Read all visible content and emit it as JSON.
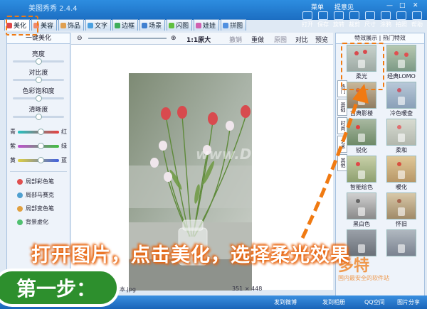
{
  "app": {
    "title": "美图秀秀 2.4.4",
    "menu": "菜单",
    "tip": "提意见"
  },
  "tabs": [
    {
      "label": "美化",
      "color": "#e04848"
    },
    {
      "label": "美容",
      "color": "#f08a6a"
    },
    {
      "label": "饰品",
      "color": "#e0a050"
    },
    {
      "label": "文字",
      "color": "#4aa0e0"
    },
    {
      "label": "边框",
      "color": "#3fae5a"
    },
    {
      "label": "场景",
      "color": "#4080d0"
    },
    {
      "label": "闪图",
      "color": "#60c040"
    },
    {
      "label": "娃娃",
      "color": "#d060b0"
    },
    {
      "label": "拼图",
      "color": "#5090e0"
    }
  ],
  "toolbar": [
    "打开",
    "保存",
    "旋转",
    "裁剪",
    "尺寸",
    "涂鸦",
    "拍照",
    "帮助"
  ],
  "left": {
    "header": "一键美化",
    "sliders": [
      "亮度",
      "对比度",
      "色彩饱和度",
      "清晰度"
    ],
    "colors": [
      {
        "left": "青",
        "right": "红",
        "gradient": "linear-gradient(90deg,#22c3c3,#e84040)"
      },
      {
        "left": "紫",
        "right": "绿",
        "gradient": "linear-gradient(90deg,#c050d0,#40c040)"
      },
      {
        "left": "黄",
        "right": "蓝",
        "gradient": "linear-gradient(90deg,#e0d040,#4060e0)"
      }
    ],
    "brushes": [
      {
        "label": "局部彩色笔",
        "color": "#e05050"
      },
      {
        "label": "局部马赛克",
        "color": "#50a0d0"
      },
      {
        "label": "局部变色笔",
        "color": "#e0a040"
      },
      {
        "label": "背景虚化",
        "color": "#50c070"
      }
    ]
  },
  "work": {
    "zoom": "1:1原大",
    "undo": "撤销",
    "redo": "重做",
    "orig": "原图",
    "compare": "对比",
    "preview": "预览",
    "status_left": "副本.jpg",
    "status_size": "351 × 448"
  },
  "right": {
    "header": "特效展示 | 热门特效",
    "side_tabs": [
      "热门",
      "基础",
      "时尚",
      "艺术",
      "其他"
    ],
    "thumbs": [
      "柔光",
      "经典LOMO",
      "古典影楼",
      "冷色暖查",
      "锐化",
      "柔和",
      "智能绘色",
      "暖化",
      "黑白色",
      "怀旧",
      "",
      ""
    ]
  },
  "overlay": {
    "caption": "打开图片，点击美化，选择柔光效果",
    "step": "第一步：",
    "watermark": "www.DuoTe.com",
    "brand": "多特",
    "brand_sub": "国内最安全的软件站"
  },
  "bottom": {
    "b1": "发到微博",
    "b2": "发到相册",
    "b3": "QQ空间",
    "b4": "图片分享"
  }
}
